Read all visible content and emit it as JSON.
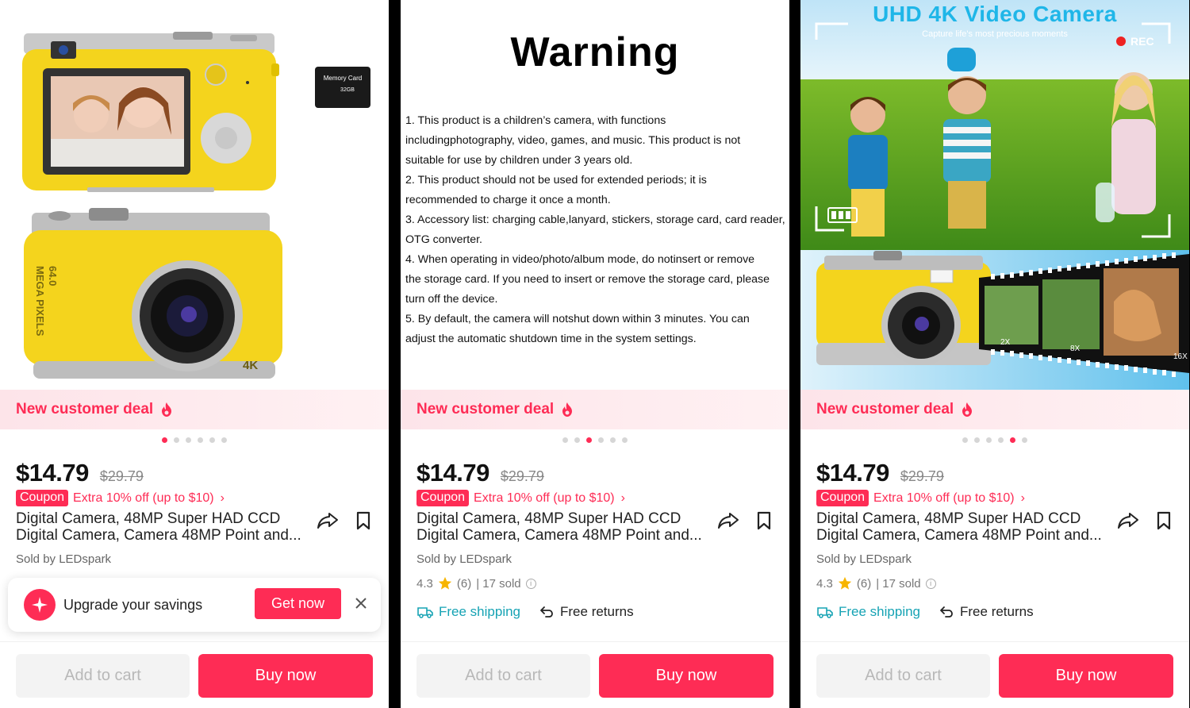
{
  "panels": [
    {
      "active_dot": 0,
      "deal_label": "New customer deal",
      "price": "$14.79",
      "original_price": "$29.79",
      "coupon_badge": "Coupon",
      "coupon_text": "Extra 10% off (up to $10)",
      "title_line1": "Digital Camera, 48MP Super HAD CCD",
      "title_line2": "Digital Camera, Camera 48MP Point and...",
      "seller": "Sold by LEDspark",
      "upgrade_text": "Upgrade your savings",
      "get_now": "Get now",
      "add_to_cart": "Add to cart",
      "buy_now": "Buy now",
      "memory_card_label": "Memory Card",
      "memory_card_size": "32GB",
      "camera_text_mp": "64.0",
      "camera_text_mega": "MEGA PIXELS",
      "camera_text_4k": "4K"
    },
    {
      "active_dot": 2,
      "warning_title": "Warning",
      "warning_lines": [
        "1. This product is a children’s camera, with functions",
        " includingphotography, video, games, and music. This product is not",
        "suitable for use by children under 3 years old.",
        "2. This product should not be used for extended periods; it is",
        "recommended to charge it once a month.",
        "3. Accessory list: charging cable,lanyard, stickers, storage card, card reader,",
        " OTG converter.",
        "4. When operating in video/photo/album mode, do notinsert or remove",
        "the storage card. If you need to insert or remove the storage card, please",
        " turn off the device.",
        "5. By default, the camera will notshut down within 3 minutes. You can",
        "adjust the automatic shutdown time in the system settings."
      ],
      "deal_label": "New customer deal",
      "price": "$14.79",
      "original_price": "$29.79",
      "coupon_badge": "Coupon",
      "coupon_text": "Extra 10% off (up to $10)",
      "title_line1": "Digital Camera, 48MP Super HAD CCD",
      "title_line2": "Digital Camera, Camera 48MP Point and...",
      "seller": "Sold by LEDspark",
      "rating": "4.3",
      "reviews": "(6)",
      "sold": "| 17 sold",
      "free_shipping": "Free shipping",
      "free_returns": "Free returns",
      "add_to_cart": "Add to cart",
      "buy_now": "Buy now"
    },
    {
      "active_dot": 4,
      "banner_title": "UHD 4K Video Camera",
      "banner_subtitle": "Capture life's most precious moments",
      "rec_label": "REC",
      "zoom_labels": [
        "2X",
        "8X",
        "16X"
      ],
      "deal_label": "New customer deal",
      "price": "$14.79",
      "original_price": "$29.79",
      "coupon_badge": "Coupon",
      "coupon_text": "Extra 10% off (up to $10)",
      "title_line1": "Digital Camera, 48MP Super HAD CCD",
      "title_line2": "Digital Camera, Camera 48MP Point and...",
      "seller": "Sold by LEDspark",
      "rating": "4.3",
      "reviews": "(6)",
      "sold": "| 17 sold",
      "free_shipping": "Free shipping",
      "free_returns": "Free returns",
      "add_to_cart": "Add to cart",
      "buy_now": "Buy now"
    }
  ],
  "carousel_count": 6,
  "colors": {
    "accent": "#fe2c55",
    "shipping": "#16a3b4",
    "camera_yellow": "#f4d41d",
    "banner_title": "#1fb6e8",
    "star": "#f7b500"
  },
  "icons": [
    "fire-icon",
    "share-icon",
    "bookmark-icon",
    "star-icon",
    "info-icon",
    "truck-icon",
    "return-icon",
    "sparkle-icon",
    "close-icon"
  ]
}
